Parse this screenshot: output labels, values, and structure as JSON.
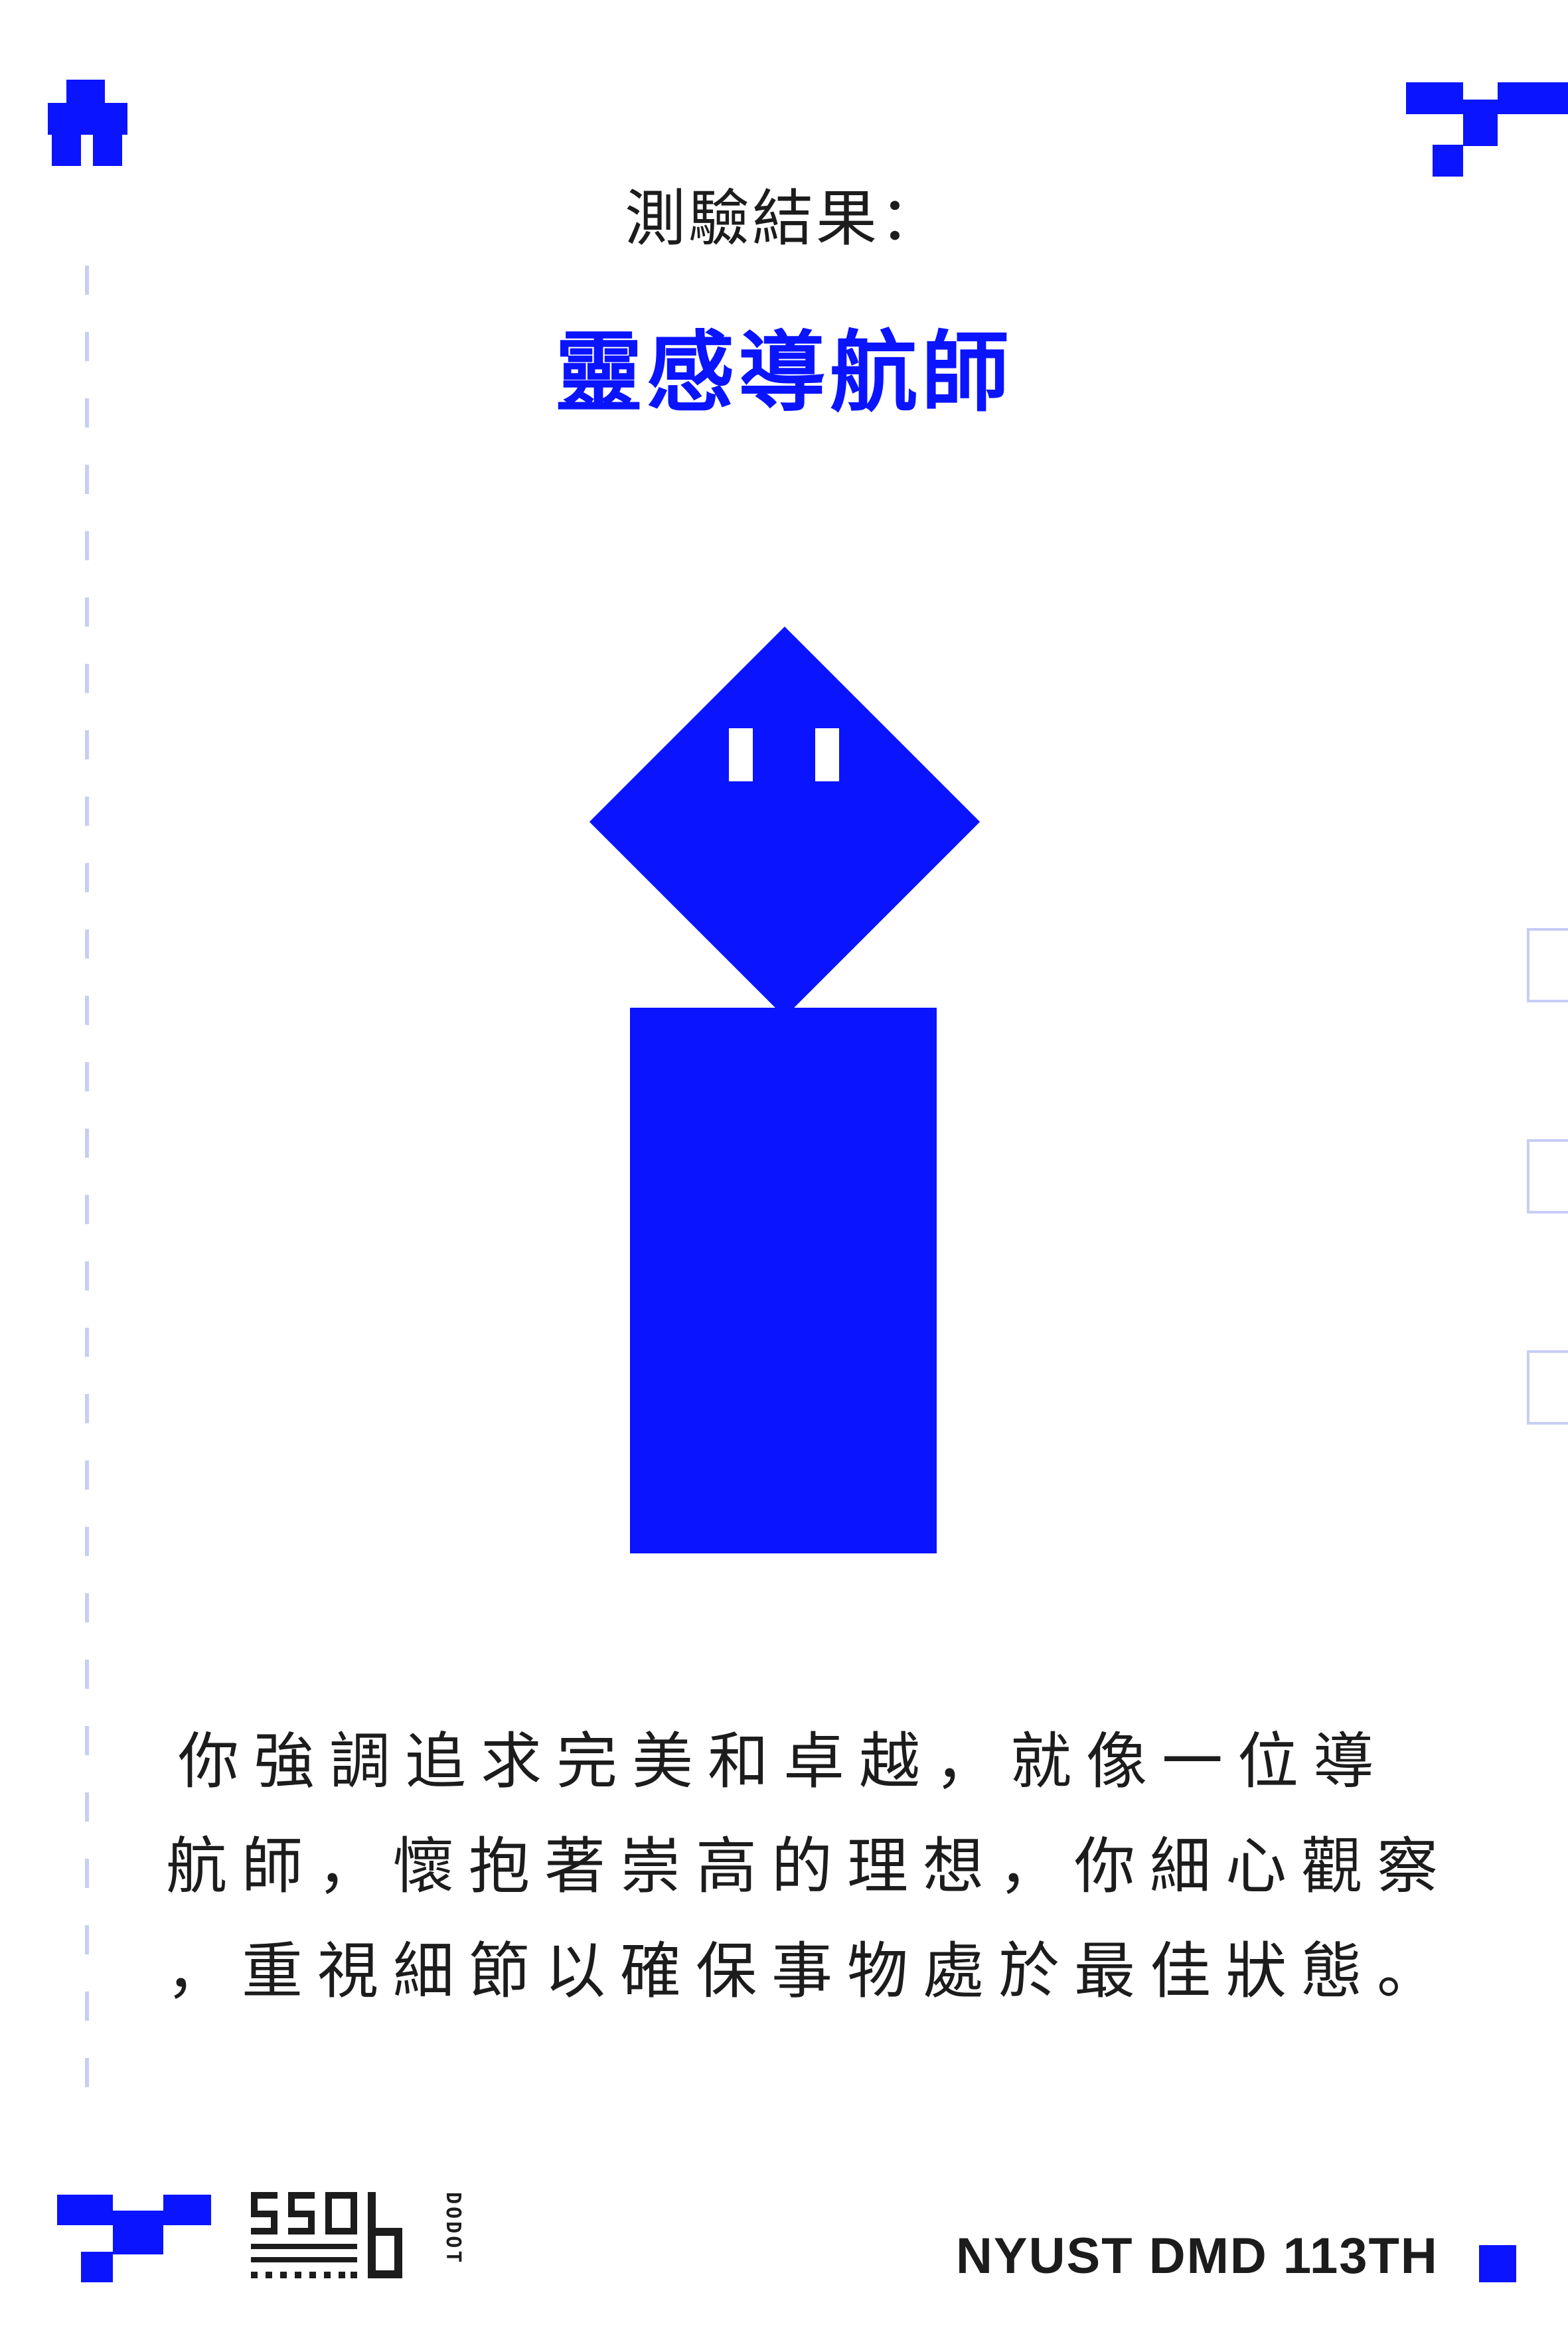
{
  "colors": {
    "accent": "#0a14ff",
    "dash": "#c7cdf6",
    "text": "#1c1c1c",
    "background": "#ffffff"
  },
  "header": {
    "label": "測驗結果：",
    "result_name": "靈感導航師"
  },
  "character": {
    "icon": "blue-robot-character"
  },
  "description": {
    "lines": [
      "你強調追求完美和卓越，就像一位導",
      "航師，懷抱著崇高的理想，你細心觀察",
      "，重視細節以確保事物處於最佳狀態。"
    ]
  },
  "footer": {
    "brand_logo_text": "ssob",
    "brand_sub": "DODOT",
    "credit": "NYUST DMD 113TH"
  }
}
